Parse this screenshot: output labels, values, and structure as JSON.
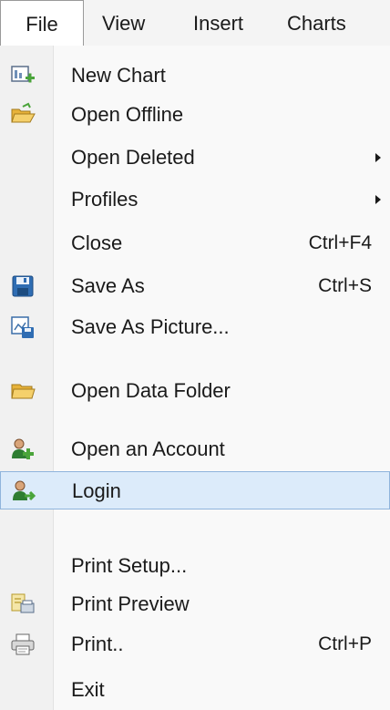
{
  "menubar": {
    "tabs": [
      "File",
      "View",
      "Insert",
      "Charts"
    ]
  },
  "file_menu": {
    "items": [
      {
        "label": "New Chart",
        "icon": "new-chart-icon"
      },
      {
        "label": "Open Offline",
        "icon": "open-folder-icon"
      },
      {
        "label": "Open Deleted",
        "submenu": true
      },
      {
        "label": "Profiles",
        "submenu": true
      },
      {
        "label": "Close",
        "shortcut": "Ctrl+F4"
      },
      {
        "label": "Save As",
        "shortcut": "Ctrl+S",
        "icon": "save-icon"
      },
      {
        "label": "Save As Picture...",
        "icon": "save-picture-icon"
      },
      {
        "label": "Open Data Folder",
        "icon": "folder-icon"
      },
      {
        "label": "Open an Account",
        "icon": "account-icon"
      },
      {
        "label": "Login",
        "icon": "login-icon",
        "highlighted": true
      },
      {
        "label": "Print Setup..."
      },
      {
        "label": "Print Preview",
        "icon": "print-preview-icon"
      },
      {
        "label": "Print..",
        "shortcut": "Ctrl+P",
        "icon": "printer-icon"
      },
      {
        "label": "Exit"
      }
    ]
  },
  "colors": {
    "highlight_bg": "#dcebfa",
    "highlight_border": "#8fb4dc",
    "icon_green": "#4aa43a",
    "icon_folder": "#f2c14e",
    "icon_blue": "#2f6db3"
  }
}
